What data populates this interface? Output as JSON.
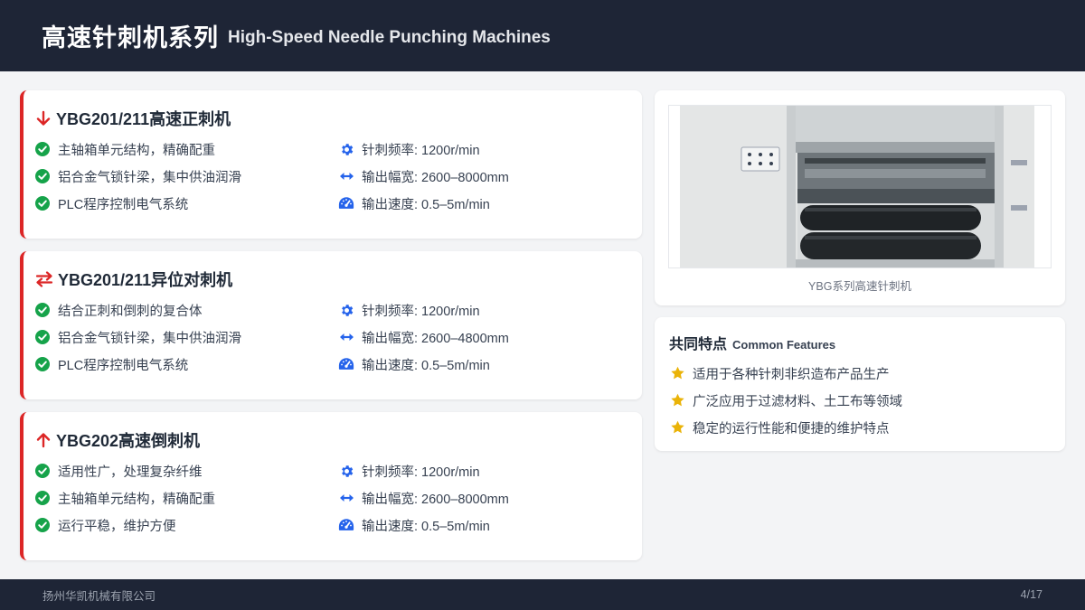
{
  "header": {
    "title_cn": "高速针刺机系列",
    "title_en": "High-Speed Needle Punching Machines"
  },
  "colors": {
    "header_bg": "#1e2536",
    "accent_red": "#dc2626",
    "check_green": "#16a34a",
    "spec_blue": "#2563eb",
    "star_gold": "#eab308"
  },
  "machines": [
    {
      "title": "YBG201/211高速正刺机",
      "icon": "arrow-down-icon",
      "features": [
        "主轴箱单元结构，精确配重",
        "铝合金气锁针梁，集中供油润滑",
        "PLC程序控制电气系统"
      ],
      "specs": [
        {
          "icon": "gear-icon",
          "text": "针刺频率: 1200r/min"
        },
        {
          "icon": "arrows-left-right-icon",
          "text": "输出幅宽: 2600–8000mm"
        },
        {
          "icon": "gauge-icon",
          "text": "输出速度: 0.5–5m/min"
        }
      ]
    },
    {
      "title": "YBG201/211异位对刺机",
      "icon": "exchange-icon",
      "features": [
        "结合正刺和倒刺的复合体",
        "铝合金气锁针梁，集中供油润滑",
        "PLC程序控制电气系统"
      ],
      "specs": [
        {
          "icon": "gear-icon",
          "text": "针刺频率: 1200r/min"
        },
        {
          "icon": "arrows-left-right-icon",
          "text": "输出幅宽: 2600–4800mm"
        },
        {
          "icon": "gauge-icon",
          "text": "输出速度: 0.5–5m/min"
        }
      ]
    },
    {
      "title": "YBG202高速倒刺机",
      "icon": "arrow-up-icon",
      "features": [
        "适用性广，处理复杂纤维",
        "主轴箱单元结构，精确配重",
        "运行平稳，维护方便"
      ],
      "specs": [
        {
          "icon": "gear-icon",
          "text": "针刺频率: 1200r/min"
        },
        {
          "icon": "arrows-left-right-icon",
          "text": "输出幅宽: 2600–8000mm"
        },
        {
          "icon": "gauge-icon",
          "text": "输出速度: 0.5–5m/min"
        }
      ]
    }
  ],
  "photo": {
    "caption": "YBG系列高速针刺机"
  },
  "common_features": {
    "title_cn": "共同特点",
    "title_en": "Common Features",
    "items": [
      "适用于各种针刺非织造布产品生产",
      "广泛应用于过滤材料、土工布等领域",
      "稳定的运行性能和便捷的维护特点"
    ]
  },
  "footer": {
    "company": "扬州华凯机械有限公司",
    "page": "4/17"
  }
}
